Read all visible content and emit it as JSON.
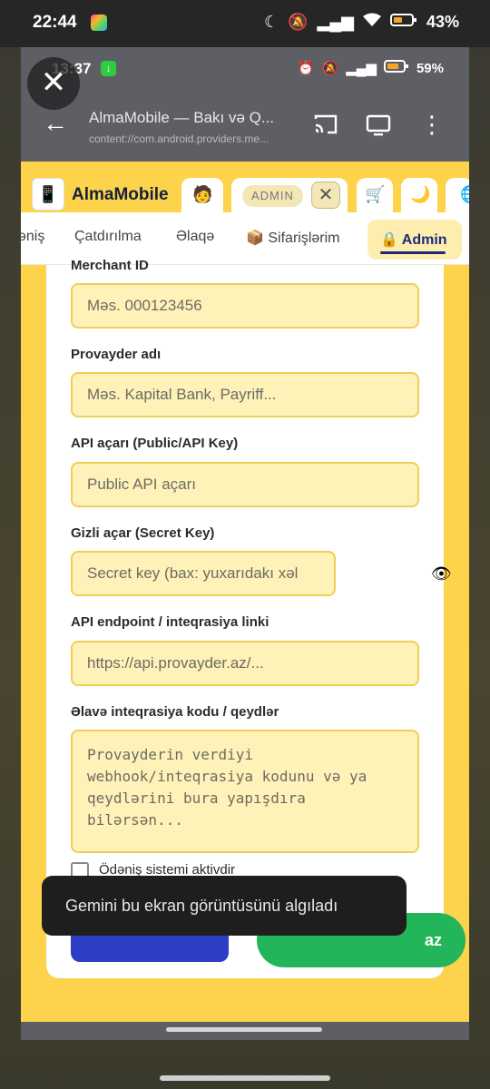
{
  "outer_status": {
    "time": "22:44",
    "battery": "43%"
  },
  "inner_status": {
    "time": "13:37",
    "battery": "59%"
  },
  "browser": {
    "title": "AlmaMobile — Bakı və Q...",
    "url": "content://com.android.providers.me..."
  },
  "site": {
    "brand": "AlmaMobile",
    "admin_tag": "ADMIN",
    "admin_close": "✕"
  },
  "tabs": [
    {
      "label": "əniş"
    },
    {
      "label": "Çatdırılma"
    },
    {
      "label": "Əlaqə"
    },
    {
      "label": "📦 Sifarişlərim"
    },
    {
      "label": "🔒 Admin"
    }
  ],
  "form": {
    "merchant_label": "Merchant ID",
    "merchant_placeholder": "Məs. 000123456",
    "provider_label": "Provayder adı",
    "provider_placeholder": "Məs. Kapital Bank, Payriff...",
    "api_key_label": "API açarı (Public/API Key)",
    "api_key_placeholder": "Public API açarı",
    "secret_label": "Gizli açar (Secret Key)",
    "secret_placeholder": "Secret key (bax: yuxarıdakı xəl",
    "endpoint_label": "API endpoint / inteqrasiya linki",
    "endpoint_placeholder": "https://api.provayder.az/...",
    "notes_label": "Əlavə inteqrasiya kodu / qeydlər",
    "notes_placeholder": "Provayderin verdiyi webhook/inteqrasiya kodunu və ya qeydlərini bura yapışdıra bilərsən...",
    "active_label": "Ödəniş sistemi aktivdir",
    "active_checked": false
  },
  "green_button_label": "az",
  "toast": "Gemini bu ekran görüntüsünü algıladı",
  "colors": {
    "page_bg": "#fcd34a",
    "field_bg": "#fff2b8",
    "field_border": "#efcf58",
    "accent_blue": "#2e3fc7",
    "accent_green": "#22b559"
  },
  "icons": [
    "close-icon",
    "back-arrow-icon",
    "cast-icon",
    "desktop-icon",
    "more-vert-icon",
    "eye-icon",
    "cart-icon",
    "moon-icon",
    "globe-icon",
    "user-icon"
  ]
}
